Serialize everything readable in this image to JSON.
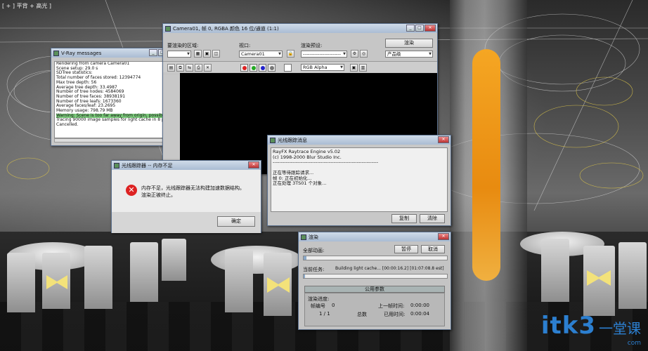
{
  "viewport": {
    "label": "[ + ] 平背 + 高光 ]"
  },
  "vray_window": {
    "title": "V-Ray messages",
    "log": [
      "Rendering from camera Camera01",
      "Scene setup: 29.0 s",
      "SDTree statistics:",
      "Total number of faces stored: 12394774",
      "Max tree depth: 56",
      "Average tree depth: 33.4987",
      "Number of tree nodes: 4584069",
      "Number of tree faces: 38938191",
      "Number of tree leafs: 1673360",
      "Average faces/leaf: 23.2695",
      "Memory usage: 798.79 MB",
      "Warning: Scene is too far away from origin, possible raycast e",
      "Tracing 90000 image samples for light cache in 8 passes.",
      "Cancelled."
    ]
  },
  "frame_buffer": {
    "title": "Camera01, 帧 0, RGBA 颜色 16 位/通道 (1:1)",
    "area_label": "要渲染的区域:",
    "viewport_label": "视口:",
    "viewport_value": "Camera01",
    "preset_label": "渲染预设:",
    "preset_value": "-----------------------",
    "render_button": "渲染",
    "product_value": "产品级",
    "channel_value": "RGB Alpha"
  },
  "error_dialog": {
    "title": "光线跟踪器 -- 内存不足",
    "message_line1": "内存不足，光线跟踪器无法构建加速数据结构。",
    "message_line2": "渲染正被终止。",
    "ok_button": "确定"
  },
  "rayfx": {
    "title": "光线跟踪消息",
    "lines": [
      "RayFX Raytrace Engine v5.02",
      "(c) 1998-2000 Blur Studio Inc.",
      "----------------------------------------------------------------",
      "",
      "正在等待跟踪请求...",
      "帧 0: 正在初始化...",
      "正在处理 3TS01 个对象..."
    ],
    "copy_button": "复制",
    "clear_button": "清除"
  },
  "render_progress": {
    "title": "渲染",
    "all_frames_label": "全部动画:",
    "pause_button": "暂停",
    "cancel_button": "取消",
    "current_task_label": "当前任务:",
    "current_task_value": "Building light cache... [00:00:16.2] [01:07:08.8 est]",
    "common_params": "公用参数",
    "progress_label": "渲染进度:",
    "frame_label": "帧编号",
    "frame_value": "0",
    "frame_count": "1 / 1",
    "total_label": "总数",
    "last_frame_time_label": "上一帧时间:",
    "last_frame_time": "0:00:00",
    "elapsed_label": "已用时间:",
    "elapsed_time": "0:00:04"
  },
  "watermark": {
    "main": "itk3",
    "sub": "一堂课",
    "suffix": "com"
  },
  "colors": {
    "accent": "#2c7fd0",
    "ribbon": "#f5a623",
    "error": "#dd2222"
  }
}
